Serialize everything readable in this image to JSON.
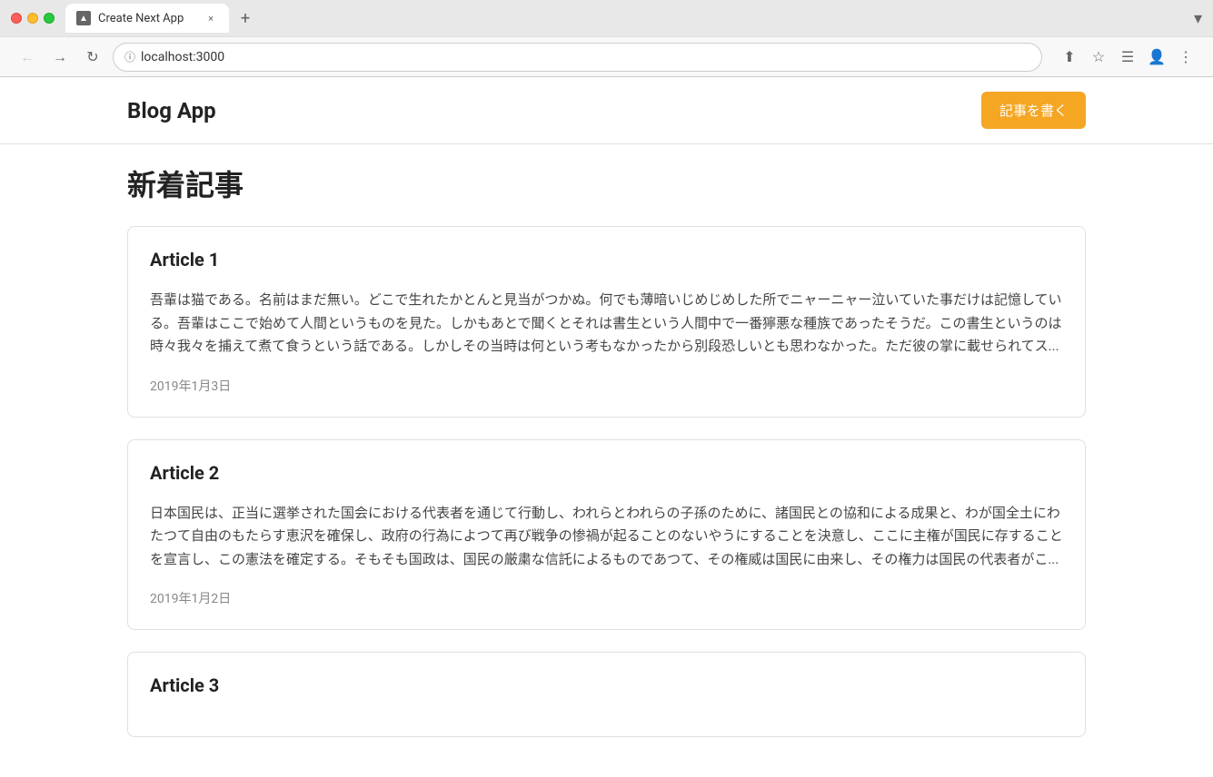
{
  "browser": {
    "tab_title": "Create Next App",
    "url": "localhost:3000",
    "tab_close_label": "×",
    "new_tab_label": "+",
    "dropdown_label": "▾"
  },
  "header": {
    "brand": "Blog App",
    "write_button": "記事を書く"
  },
  "main": {
    "section_title": "新着記事",
    "articles": [
      {
        "title": "Article 1",
        "body": "吾輩は猫である。名前はまだ無い。どこで生れたかとんと見当がつかぬ。何でも薄暗いじめじめした所でニャーニャー泣いていた事だけは記憶している。吾輩はここで始めて人間というものを見た。しかもあとで聞くとそれは書生という人間中で一番獰悪な種族であったそうだ。この書生というのは時々我々を捕えて煮て食うという話である。しかしその当時は何という考もなかったから別段恐しいとも思わなかった。ただ彼の掌に載せられてス...",
        "date": "2019年1月3日"
      },
      {
        "title": "Article 2",
        "body": "日本国民は、正当に選挙された国会における代表者を通じて行動し、われらとわれらの子孫のために、諸国民との協和による成果と、わが国全土にわたつて自由のもたらす恵沢を確保し、政府の行為によつて再び戦争の惨禍が起ることのないやうにすることを決意し、ここに主権が国民に存することを宣言し、この憲法を確定する。そもそも国政は、国民の厳粛な信託によるものであつて、その権威は国民に由来し、その権力は国民の代表者がこ...",
        "date": "2019年1月2日"
      },
      {
        "title": "Article 3",
        "body": "",
        "date": ""
      }
    ]
  }
}
